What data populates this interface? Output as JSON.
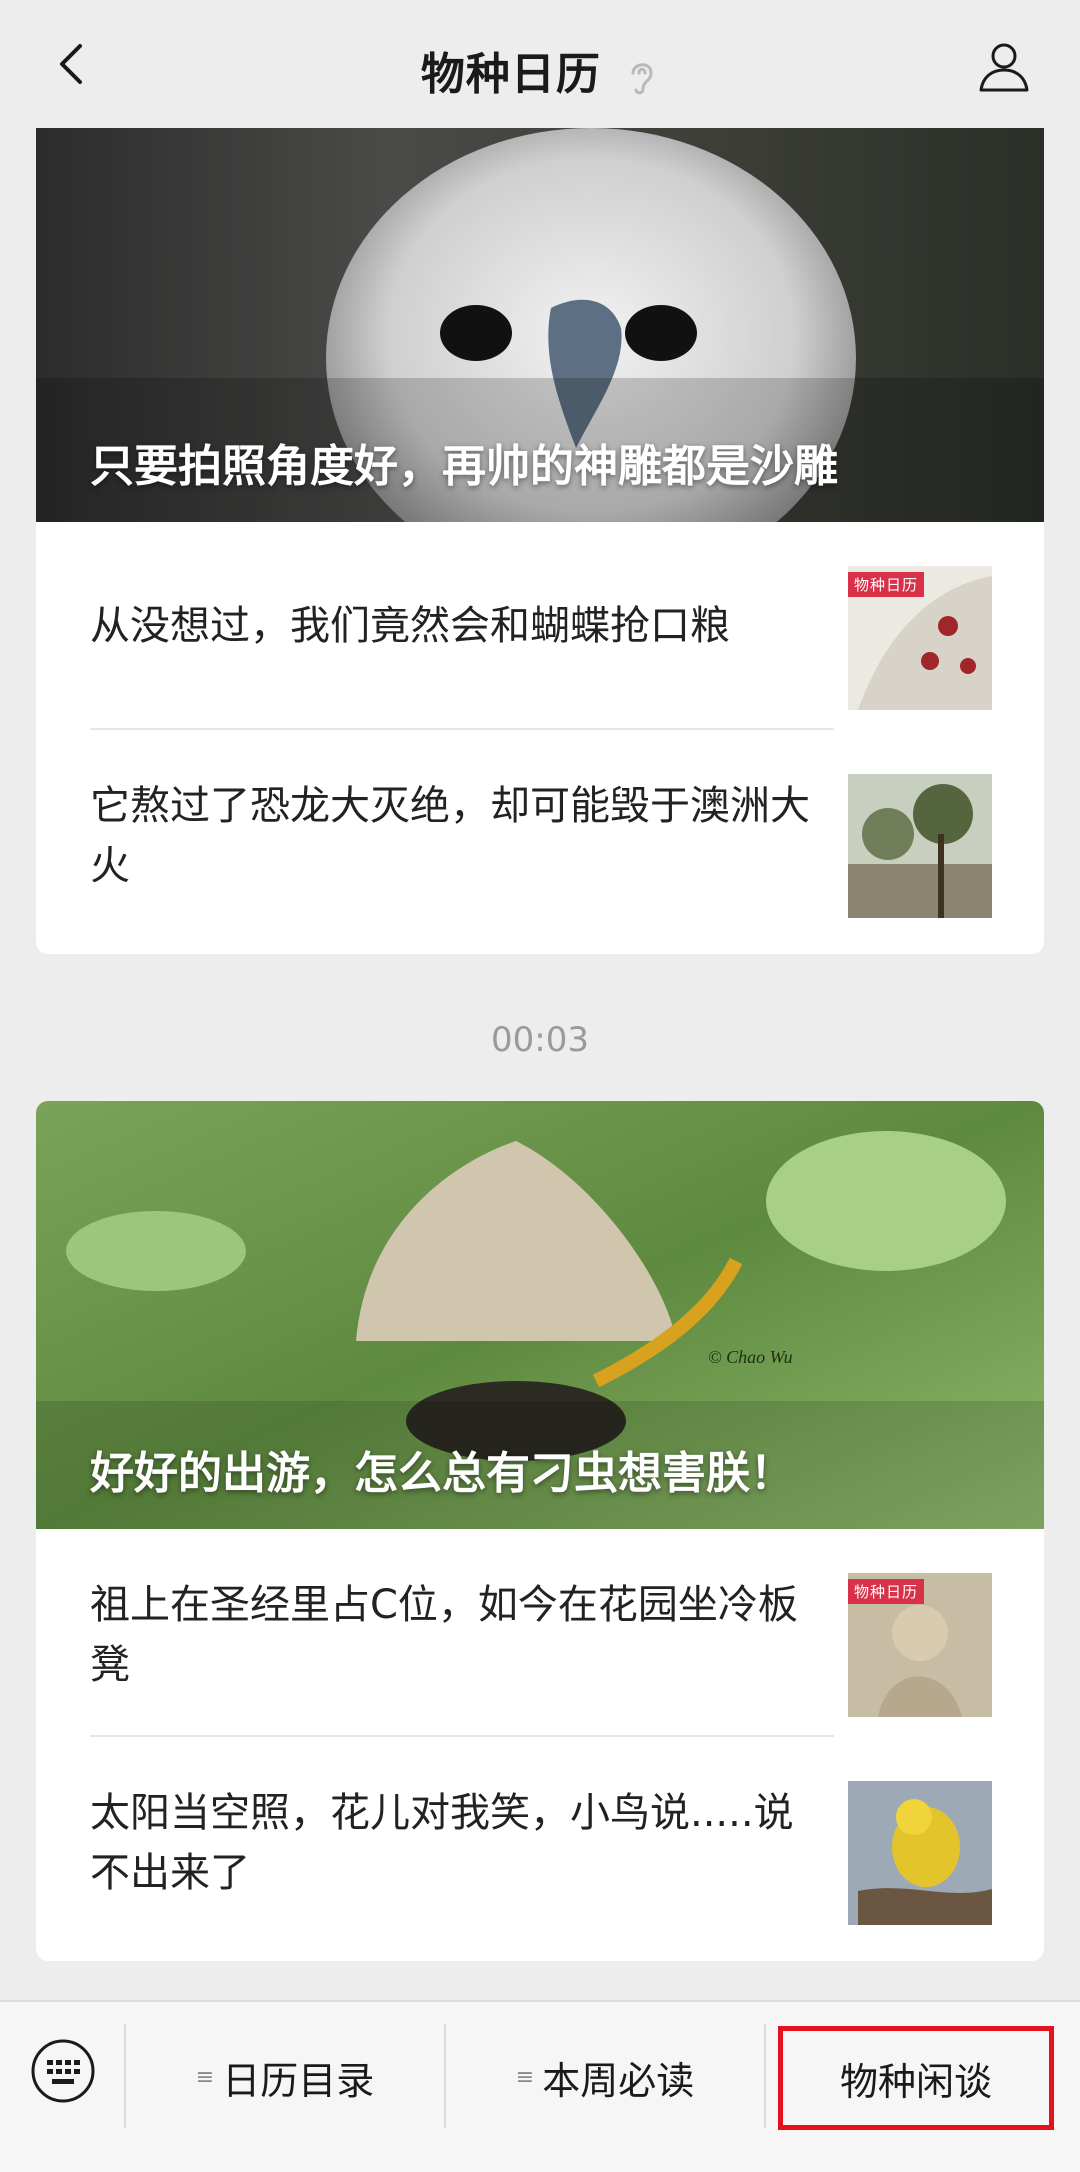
{
  "header": {
    "title": "物种日历",
    "back_icon": "chevron-left-icon",
    "ear_icon": "ear-icon",
    "user_icon": "user-icon"
  },
  "cards": [
    {
      "hero_title": "只要拍照角度好，再帅的神雕都是沙雕",
      "items": [
        {
          "text": "从没想过，我们竟然会和蝴蝶抢口粮",
          "thumb_tag": "物种日历"
        },
        {
          "text": "它熬过了恐龙大灭绝，却可能毁于澳洲大火",
          "thumb_tag": ""
        }
      ]
    },
    {
      "hero_title": "好好的出游，怎么总有刁虫想害朕！",
      "watermark": "© Chao Wu",
      "items": [
        {
          "text": "祖上在圣经里占C位，如今在花园坐冷板凳",
          "thumb_tag": "物种日历"
        },
        {
          "text": "太阳当空照，花儿对我笑，小鸟说.....说不出来了",
          "thumb_tag": ""
        }
      ]
    }
  ],
  "timestamp": "00:03",
  "bottom_menu": {
    "keyboard_icon": "keyboard-icon",
    "items": [
      {
        "label": "日历目录",
        "prefix": "≡"
      },
      {
        "label": "本周必读",
        "prefix": "≡"
      },
      {
        "label": "物种闲谈",
        "prefix": ""
      }
    ],
    "highlight_color": "#e5121e"
  }
}
